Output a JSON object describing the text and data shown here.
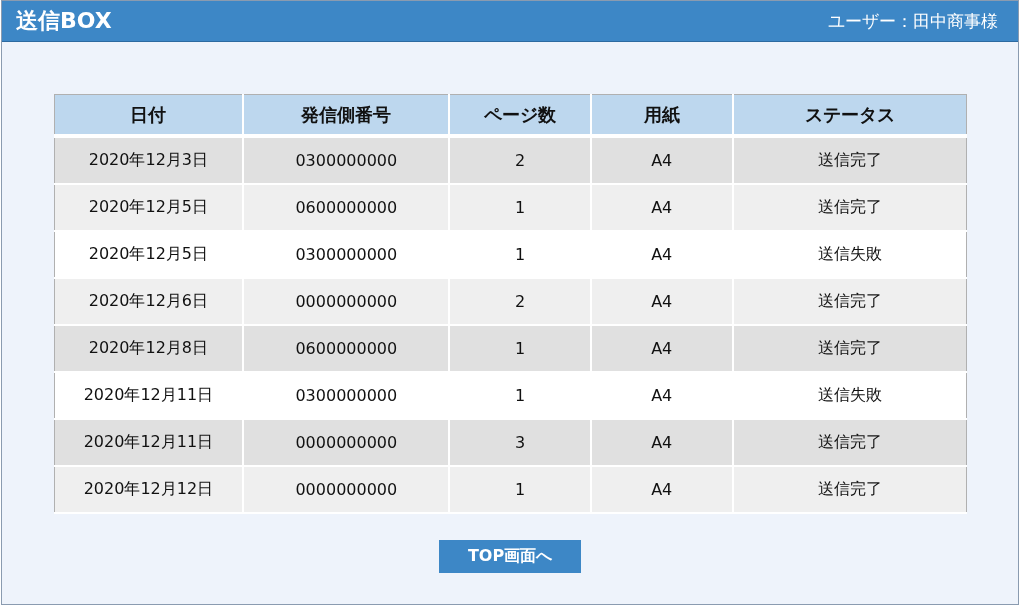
{
  "window": {
    "title": "送信BOX",
    "user": "ユーザー：田中商事様"
  },
  "table": {
    "columns": [
      "日付",
      "発信側番号",
      "ページ数",
      "用紙",
      "ステータス"
    ],
    "rows": [
      {
        "cells": [
          "2020年12月3日",
          "0300000000",
          "2",
          "A4",
          "送信完了"
        ],
        "color": "#e0e0e0"
      },
      {
        "cells": [
          "2020年12月5日",
          "0600000000",
          "1",
          "A4",
          "送信完了"
        ],
        "color": "#efefef"
      },
      {
        "cells": [
          "2020年12月5日",
          "0300000000",
          "1",
          "A4",
          "送信失敗"
        ],
        "color": "#ffffff"
      },
      {
        "cells": [
          "2020年12月6日",
          "0000000000",
          "2",
          "A4",
          "送信完了"
        ],
        "color": "#efefef"
      },
      {
        "cells": [
          "2020年12月8日",
          "0600000000",
          "1",
          "A4",
          "送信完了"
        ],
        "color": "#e0e0e0"
      },
      {
        "cells": [
          "2020年12月11日",
          "0300000000",
          "1",
          "A4",
          "送信失敗"
        ],
        "color": "#ffffff"
      },
      {
        "cells": [
          "2020年12月11日",
          "0000000000",
          "3",
          "A4",
          "送信完了"
        ],
        "color": "#e0e0e0"
      },
      {
        "cells": [
          "2020年12月12日",
          "0000000000",
          "1",
          "A4",
          "送信完了"
        ],
        "color": "#efefef"
      }
    ]
  },
  "button": "TOP画面へ"
}
